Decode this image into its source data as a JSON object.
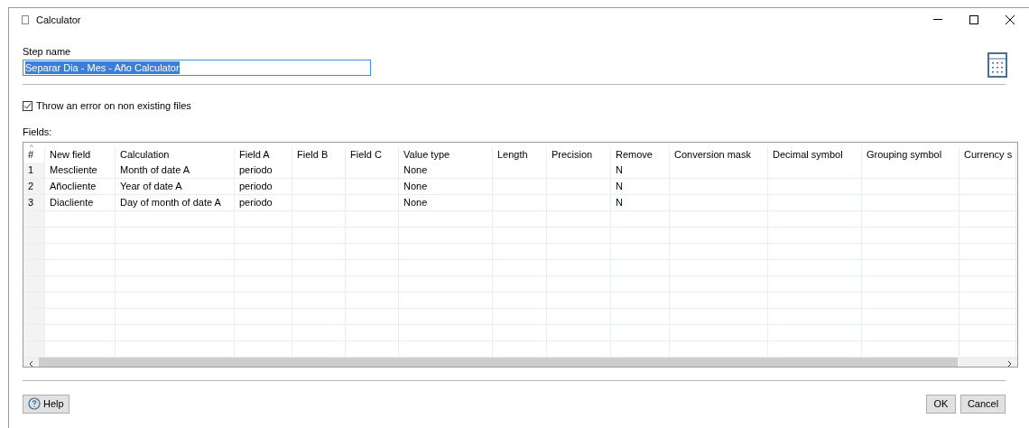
{
  "window": {
    "title": "Calculator"
  },
  "step_name": {
    "label": "Step name",
    "value": "Separar Dia - Mes - Año Calculator"
  },
  "throw_error": {
    "label": "Throw an error on non existing files",
    "checked": true
  },
  "fields": {
    "label": "Fields:",
    "sort_mark": "^",
    "columns": [
      "#",
      "New field",
      "Calculation",
      "Field A",
      "Field B",
      "Field C",
      "Value type",
      "Length",
      "Precision",
      "Remove",
      "Conversion mask",
      "Decimal symbol",
      "Grouping symbol",
      "Currency s"
    ],
    "rows": [
      [
        "1",
        "Mescliente",
        "Month of date A",
        "periodo",
        "",
        "",
        "None",
        "",
        "",
        "N",
        "",
        "",
        "",
        ""
      ],
      [
        "2",
        "Añocliente",
        "Year of date A",
        "periodo",
        "",
        "",
        "None",
        "",
        "",
        "N",
        "",
        "",
        "",
        ""
      ],
      [
        "3",
        "Diacliente",
        "Day of month of date A",
        "periodo",
        "",
        "",
        "None",
        "",
        "",
        "N",
        "",
        "",
        "",
        ""
      ]
    ]
  },
  "buttons": {
    "help": "Help",
    "ok": "OK",
    "cancel": "Cancel"
  }
}
